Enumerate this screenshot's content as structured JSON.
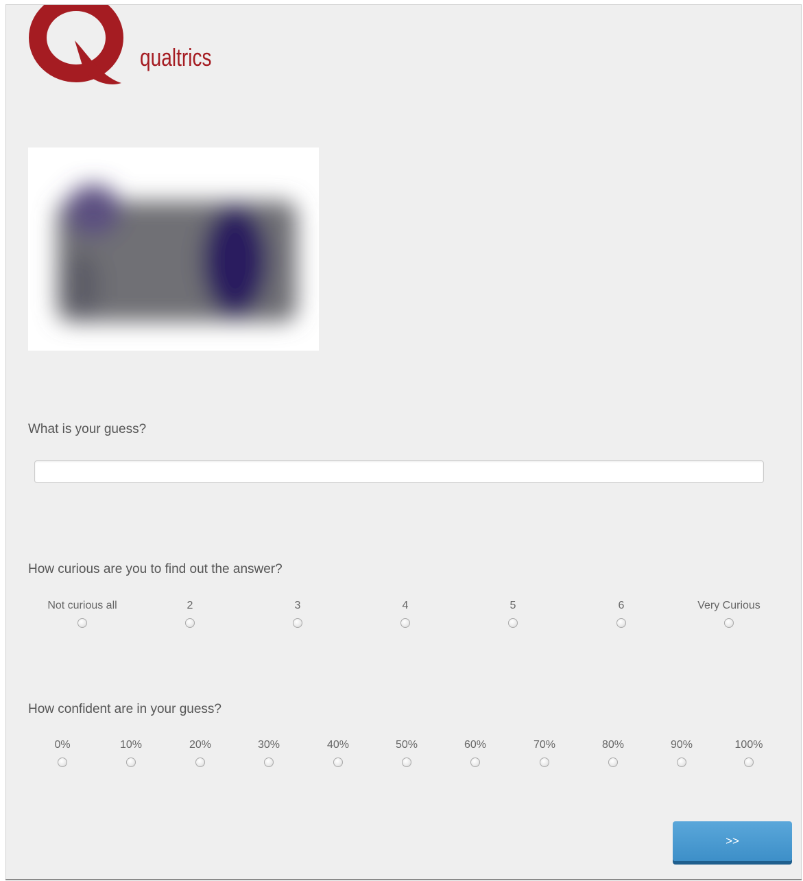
{
  "brand": {
    "name": "qualtrics",
    "color": "#a51c22"
  },
  "stimulus": {
    "icon": "blurred-image"
  },
  "q1": {
    "text": "What is your guess?",
    "value": ""
  },
  "q2": {
    "text": "How curious are you to find out the answer?",
    "choices": [
      "Not curious all",
      "2",
      "3",
      "4",
      "5",
      "6",
      "Very Curious"
    ]
  },
  "q3": {
    "text": "How confident are in your guess?",
    "choices": [
      "0%",
      "10%",
      "20%",
      "30%",
      "40%",
      "50%",
      "60%",
      "70%",
      "80%",
      "90%",
      "100%"
    ]
  },
  "nav": {
    "next_label": ">>",
    "accent": "#4a9bd1"
  }
}
